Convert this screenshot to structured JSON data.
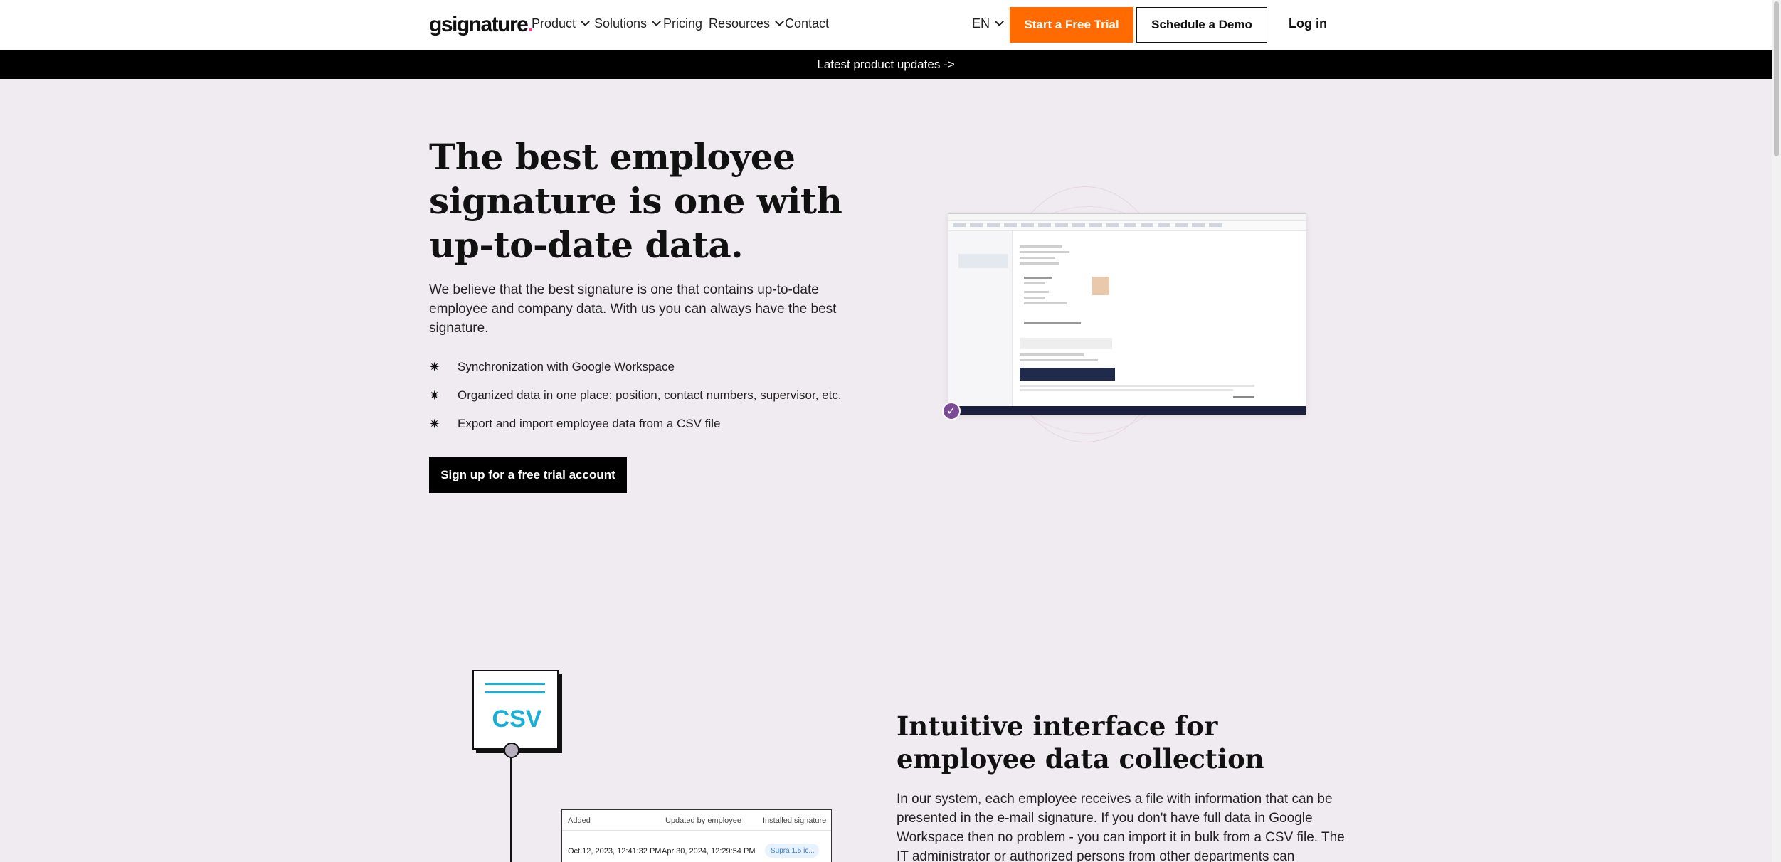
{
  "nav": {
    "logo_text": "gsignature",
    "logo_dot": ".",
    "items": [
      {
        "label": "Product",
        "has_dropdown": true,
        "icon": "chevron-down-icon"
      },
      {
        "label": "Solutions",
        "has_dropdown": true,
        "icon": "chevron-down-icon"
      },
      {
        "label": "Pricing",
        "has_dropdown": false
      },
      {
        "label": "Resources",
        "has_dropdown": true,
        "icon": "chevron-down-icon"
      },
      {
        "label": "Contact",
        "has_dropdown": false
      }
    ],
    "language": "EN",
    "trial_button": "Start a Free Trial",
    "demo_button": "Schedule a Demo",
    "login": "Log in",
    "accent_color": "#ff6b00"
  },
  "announcement": {
    "text": "Latest product updates ->"
  },
  "hero": {
    "title": "The best employee signature is one with up-to-date data.",
    "description": "We believe that the best signature is one that contains up-to-date employee and company data. With us you can always have the best signature.",
    "bullet_icon": "asterisk-icon",
    "bullet_glyph": "✷",
    "bullets": [
      "Synchronization with Google Workspace",
      "Organized data in one place: position, contact numbers, supervisor, etc.",
      "Export and import employee data from a CSV file"
    ],
    "cta": "Sign up for a free trial account",
    "image_icon": "check-icon"
  },
  "data_section": {
    "csv_label": "CSV",
    "table": {
      "headers": [
        "Added",
        "Updated by employee",
        "Installed signature"
      ],
      "row": {
        "added": "Oct 12, 2023, 12:41:32 PM",
        "updated": "Apr 30, 2024, 12:29:54 PM",
        "signature": "Supra 1.5 ic..."
      }
    },
    "title": "Intuitive interface for employee data collection",
    "description": "In our system, each employee receives a file with information that can be presented in the e-mail signature. If you don't have full data in Google Workspace then no problem - you can import it in bulk from a CSV file. The IT administrator or authorized persons from other departments can"
  }
}
